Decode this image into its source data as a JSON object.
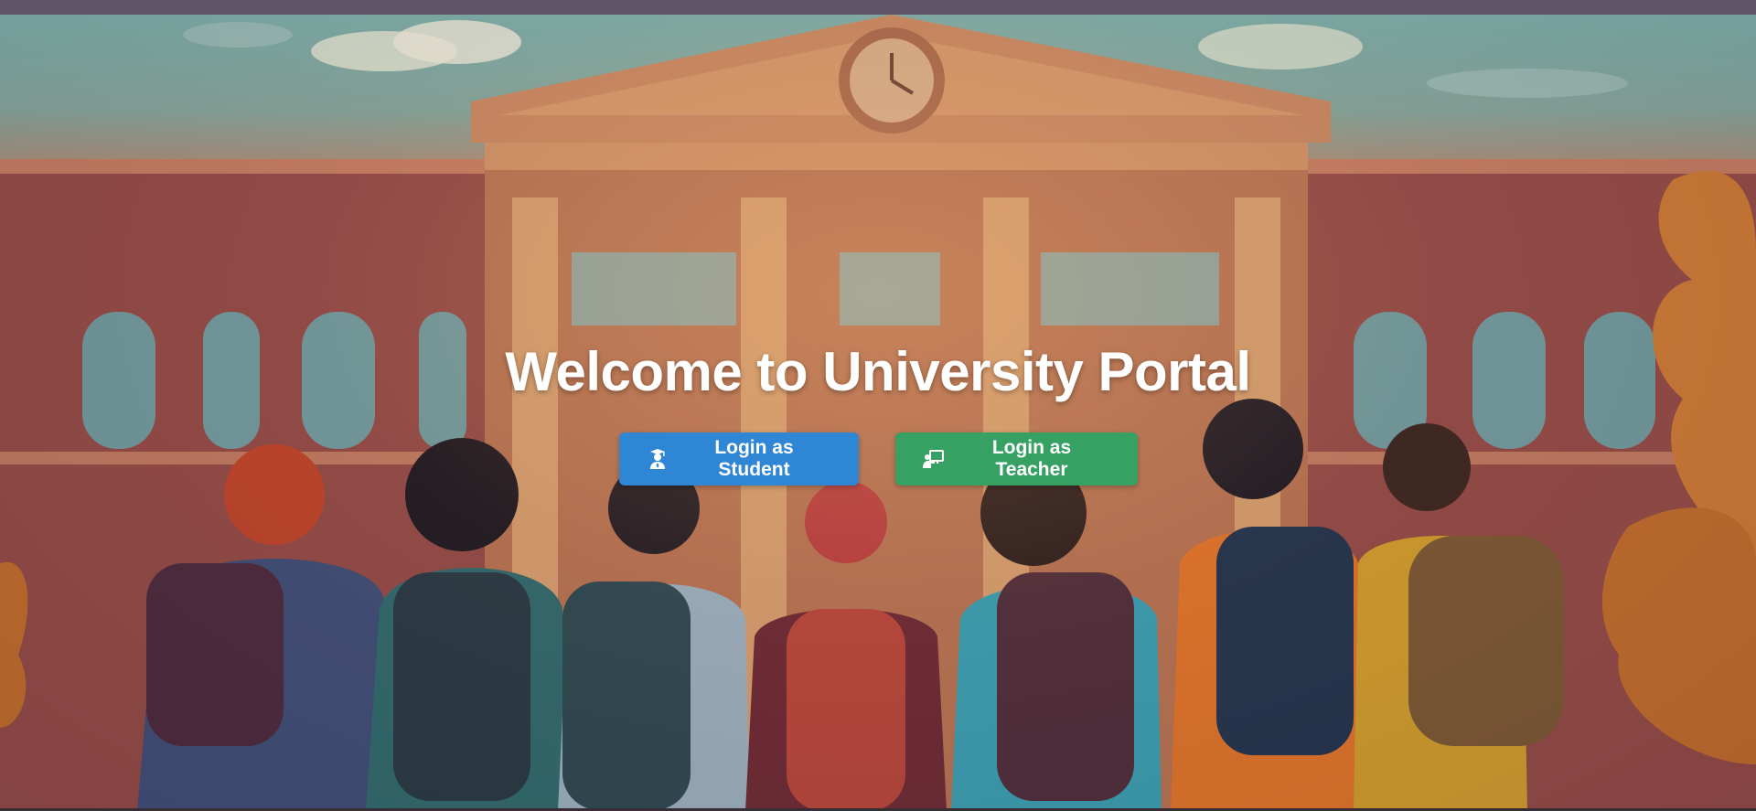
{
  "hero": {
    "title": "Welcome to University Portal"
  },
  "actions": {
    "student_label": "Login as Student",
    "student_icon": "user-graduate-icon",
    "teacher_label": "Login as Teacher",
    "teacher_icon": "chalkboard-teacher-icon"
  },
  "colors": {
    "student_button": "#2f86d4",
    "teacher_button": "#36a163",
    "title_text": "#ffffff"
  }
}
